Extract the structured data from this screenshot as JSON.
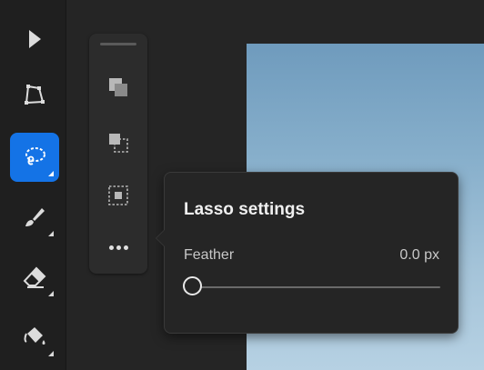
{
  "left_toolbar": {
    "tools": [
      {
        "name": "select-tool",
        "icon": "arrow-pointer-icon"
      },
      {
        "name": "transform-tool",
        "icon": "quad-transform-icon"
      },
      {
        "name": "lasso-tool",
        "icon": "lasso-icon",
        "active": true
      },
      {
        "name": "brush-tool",
        "icon": "brush-icon"
      },
      {
        "name": "eraser-tool",
        "icon": "eraser-icon"
      },
      {
        "name": "paint-bucket-tool",
        "icon": "paint-bucket-icon"
      }
    ]
  },
  "selection_modes": {
    "items": [
      {
        "name": "new-selection",
        "icon": "selection-new-icon"
      },
      {
        "name": "add-to-selection",
        "icon": "selection-add-icon"
      },
      {
        "name": "intersect-selection",
        "icon": "selection-intersect-icon"
      }
    ],
    "more_icon": "ellipsis-icon"
  },
  "lasso_settings": {
    "title": "Lasso settings",
    "feather_label": "Feather",
    "feather_value": "0.0 px",
    "feather_level": 0
  },
  "colors": {
    "accent": "#1473e6",
    "panel": "#252525",
    "toolbar": "#1f1f1f"
  }
}
